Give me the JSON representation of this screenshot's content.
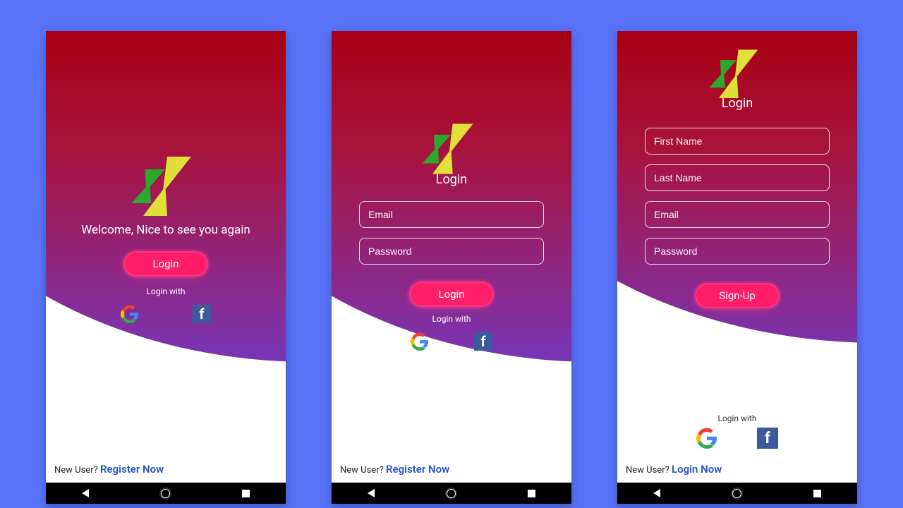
{
  "colors": {
    "accent": "#ff1e6a",
    "link": "#2a52c8"
  },
  "logo_icon": "xing-logo",
  "nav": {
    "back": "back-triangle",
    "home": "home-circle",
    "recent": "recent-square"
  },
  "screens": [
    {
      "id": "welcome",
      "welcome_text": "Welcome, Nice to see you again",
      "login_button": "Login",
      "login_with": "Login with",
      "social": {
        "google": "Google",
        "facebook": "Facebook"
      },
      "footer_prefix": "New User?",
      "footer_link": "Register Now"
    },
    {
      "id": "login",
      "heading": "Login",
      "fields": [
        "Email",
        "Password"
      ],
      "login_button": "Login",
      "login_with": "Login with",
      "social": {
        "google": "Google",
        "facebook": "Facebook"
      },
      "footer_prefix": "New User?",
      "footer_link": "Register Now"
    },
    {
      "id": "signup",
      "heading": "Login",
      "fields": [
        "First Name",
        "Last Name",
        "Email",
        "Password"
      ],
      "signup_button": "Sign-Up",
      "login_with": "Login with",
      "social": {
        "google": "Google",
        "facebook": "Facebook"
      },
      "footer_prefix": "New User?",
      "footer_link": "Login Now"
    }
  ]
}
